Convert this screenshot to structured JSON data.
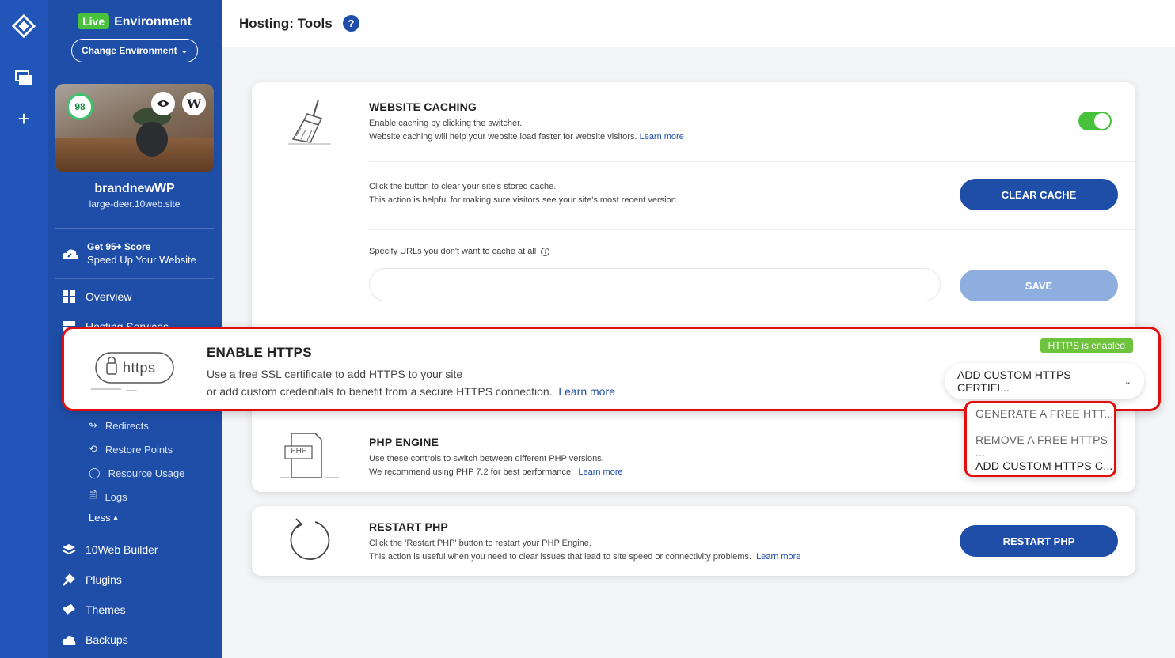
{
  "rail": {
    "items": [
      {
        "name": "logo-icon",
        "glyph": "◈"
      },
      {
        "name": "websites-icon",
        "glyph": "❐"
      },
      {
        "name": "add-icon",
        "glyph": "+"
      }
    ]
  },
  "sidebar": {
    "live_badge": "Live",
    "environment_label": "Environment",
    "change_env": "Change Environment",
    "site": {
      "score": "98",
      "name": "brandnewWP",
      "url": "large-deer.10web.site",
      "wp_glyph": "W"
    },
    "promo": {
      "line1": "Get 95+ Score",
      "line2": "Speed Up Your Website"
    },
    "nav": {
      "overview": "Overview",
      "hosting_services": "Hosting Services",
      "builder": "10Web Builder",
      "plugins": "Plugins",
      "themes": "Themes",
      "backups": "Backups"
    },
    "sub": {
      "redirects": "Redirects",
      "restore_points": "Restore Points",
      "resource_usage": "Resource Usage",
      "logs": "Logs",
      "less": "Less"
    }
  },
  "header": {
    "title": "Hosting: Tools",
    "help": "?"
  },
  "caching": {
    "title": "WEBSITE CACHING",
    "desc_line1": "Enable caching by clicking the switcher.",
    "desc_line2": "Website caching will help your website load faster for website visitors.",
    "learn_more": "Learn more",
    "enabled": true,
    "clear_line1": "Click the button to clear your site's stored cache.",
    "clear_line2": "This action is helpful for making sure visitors see your site's most recent version.",
    "clear_button": "CLEAR CACHE",
    "exclude_label": "Specify URLs you don't want to cache at all",
    "exclude_value": "",
    "save_button": "SAVE"
  },
  "https": {
    "title": "ENABLE HTTPS",
    "badge": "HTTPS is enabled",
    "desc_line1": "Use a free SSL certificate to add HTTPS to your site",
    "desc_line2": "or add custom credentials to benefit from a secure HTTPS connection.",
    "learn_more": "Learn more",
    "logo_text": "https",
    "select_value": "ADD CUSTOM HTTPS CERTIFI...",
    "options": [
      "GENERATE A FREE HTT...",
      "REMOVE A FREE HTTPS ...",
      "ADD CUSTOM HTTPS C..."
    ]
  },
  "php": {
    "title": "PHP ENGINE",
    "icon_label": "PHP",
    "desc_line1": "Use these controls to switch between different PHP versions.",
    "desc_line2": "We recommend using PHP 7.2 for best performance.",
    "learn_more": "Learn more"
  },
  "restart": {
    "title": "RESTART PHP",
    "desc_line1": "Click the 'Restart PHP' button to restart your PHP Engine.",
    "desc_line2": "This action is useful when you need to clear issues that lead to site speed or connectivity problems.",
    "learn_more": "Learn more",
    "button": "RESTART PHP"
  },
  "colors": {
    "sidebar": "#1e4ea8",
    "rail": "#2155b8",
    "primary": "#1e4ea8",
    "success": "#48c13d",
    "highlight": "#e10e0e"
  }
}
